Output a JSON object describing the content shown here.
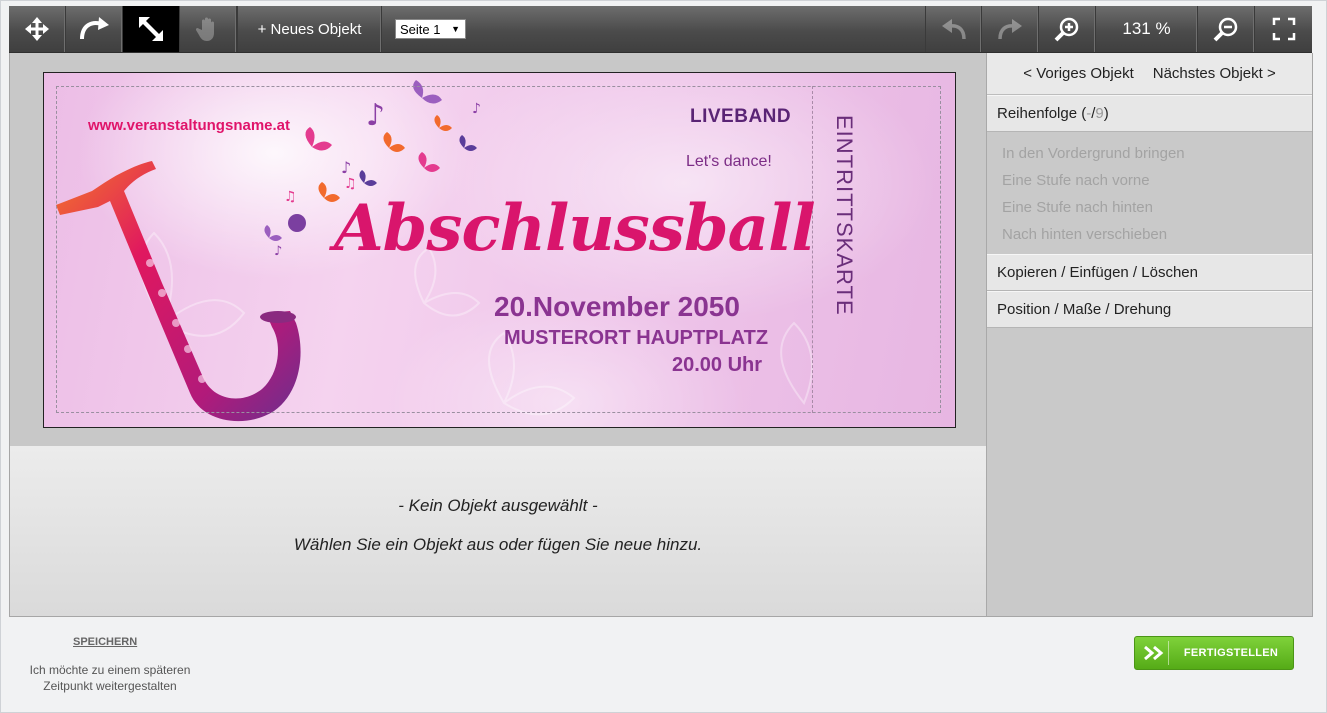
{
  "toolbar": {
    "new_object_label": "+ Neues Objekt",
    "page_select_value": "Seite 1",
    "zoom_value": "131 %",
    "tools": [
      {
        "icon": "move-icon"
      },
      {
        "icon": "rotate-icon"
      },
      {
        "icon": "resize-icon",
        "active": true
      },
      {
        "icon": "hand-icon",
        "disabled": true
      }
    ],
    "right_tools": [
      {
        "icon": "undo-icon",
        "disabled": true
      },
      {
        "icon": "redo-icon",
        "disabled": true
      },
      {
        "icon": "zoom-in-icon"
      },
      {
        "icon": "zoom-out-icon"
      },
      {
        "icon": "fullscreen-icon"
      }
    ]
  },
  "ticket": {
    "url": "www.veranstaltungsname.at",
    "liveband": "LIVEBAND",
    "tagline": "Let's dance!",
    "title": "Abschlussball",
    "date": "20.November 2050",
    "place": "MUSTERORT HAUPTPLATZ",
    "time": "20.00 Uhr",
    "stub": "EINTRITTSKARTE",
    "colors": {
      "title": "#d9156c",
      "text": "#8a3491",
      "background": "#f1c9ec"
    }
  },
  "info": {
    "line1": "- Kein Objekt ausgewählt -",
    "line2": "Wählen Sie ein Objekt aus oder fügen Sie neue hinzu."
  },
  "panel": {
    "prev_label": "< Voriges Objekt",
    "next_label": "Nächstes Objekt >",
    "order_label": "Reihenfolge (",
    "order_current": "-",
    "order_sep": " / ",
    "order_total": "9",
    "order_close": ")",
    "order_options": [
      "In den Vordergrund bringen",
      "Eine Stufe nach vorne",
      "Eine Stufe nach hinten",
      "Nach hinten verschieben"
    ],
    "copy_section": "Kopieren / Einfügen / Löschen",
    "position_section": "Position / Maße / Drehung"
  },
  "footer": {
    "save_label": "SPEICHERN",
    "save_note": "Ich möchte zu einem späteren Zeitpunkt weitergestalten",
    "finish_label": "FERTIGSTELLEN",
    "finish_color": "#5fb91f"
  }
}
